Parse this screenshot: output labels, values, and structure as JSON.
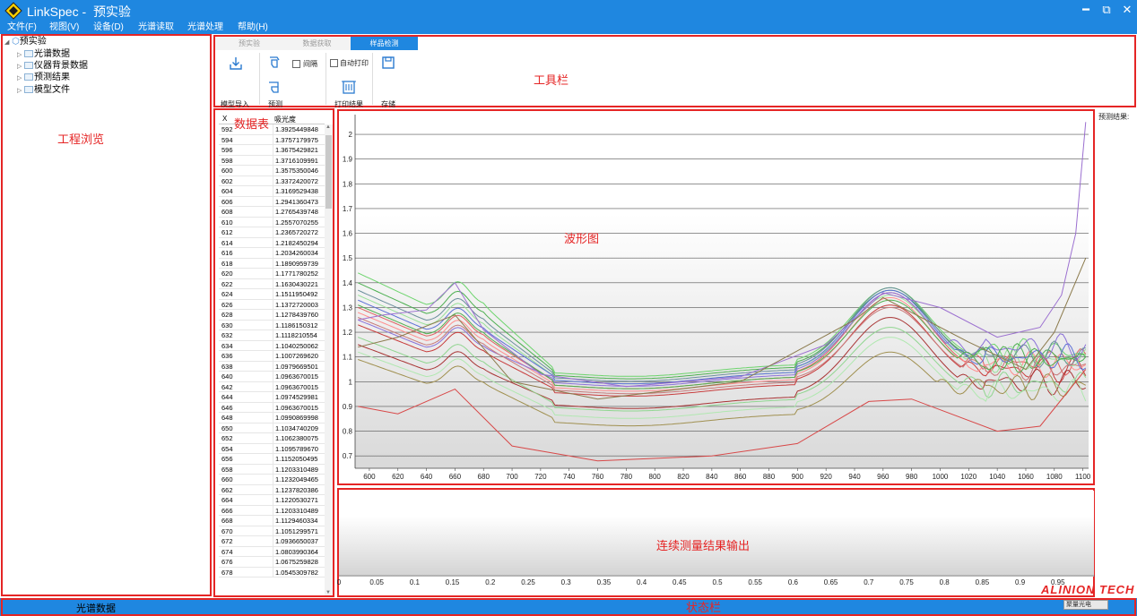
{
  "window": {
    "app_name": "LinkSpec -",
    "doc_name": "预实验",
    "minimize": "━",
    "restore": "⧉",
    "close": "✕",
    "icon": "linkspec-logo-icon"
  },
  "menu": {
    "items": [
      "文件(F)",
      "视图(V)",
      "设备(D)",
      "光谱读取",
      "光谱处理",
      "帮助(H)"
    ]
  },
  "tree": {
    "root": "预实验",
    "children": [
      "光谱数据",
      "仪器背景数据",
      "预测结果",
      "模型文件"
    ]
  },
  "tabs": {
    "items": [
      "预实验",
      "数据获取",
      "样品检测"
    ],
    "active_index": 2
  },
  "toolbar": {
    "model_import": "模型导入",
    "predict": "预测",
    "interval": "间隔",
    "auto_print": "自动打印",
    "print_result": "打印结果",
    "save": "存储",
    "predict_result_label": "预测结果:"
  },
  "annotations": {
    "project_browse": "工程浏览",
    "toolbar": "工具栏",
    "data_table": "数据表",
    "waveform": "波形图",
    "continuous_output": "连续测量结果输出",
    "statusbar": "状态栏"
  },
  "grid": {
    "col_x": "X",
    "col_y": "吸光度",
    "rows": [
      [
        "592",
        "1.3925449848"
      ],
      [
        "594",
        "1.3757179975"
      ],
      [
        "596",
        "1.3675429821"
      ],
      [
        "598",
        "1.3716109991"
      ],
      [
        "600",
        "1.3575350046"
      ],
      [
        "602",
        "1.3372420072"
      ],
      [
        "604",
        "1.3169529438"
      ],
      [
        "606",
        "1.2941360473"
      ],
      [
        "608",
        "1.2765439748"
      ],
      [
        "610",
        "1.2557070255"
      ],
      [
        "612",
        "1.2365720272"
      ],
      [
        "614",
        "1.2182450294"
      ],
      [
        "616",
        "1.2034260034"
      ],
      [
        "618",
        "1.1890959739"
      ],
      [
        "620",
        "1.1771780252"
      ],
      [
        "622",
        "1.1630430221"
      ],
      [
        "624",
        "1.1511950492"
      ],
      [
        "626",
        "1.1372720003"
      ],
      [
        "628",
        "1.1278439760"
      ],
      [
        "630",
        "1.1186150312"
      ],
      [
        "632",
        "1.1118210554"
      ],
      [
        "634",
        "1.1040250062"
      ],
      [
        "636",
        "1.1007269620"
      ],
      [
        "638",
        "1.0979669501"
      ],
      [
        "640",
        "1.0963670015"
      ],
      [
        "642",
        "1.0963670015"
      ],
      [
        "644",
        "1.0974529981"
      ],
      [
        "646",
        "1.0963670015"
      ],
      [
        "648",
        "1.0990869998"
      ],
      [
        "650",
        "1.1034740209"
      ],
      [
        "652",
        "1.1062380075"
      ],
      [
        "654",
        "1.1095789670"
      ],
      [
        "656",
        "1.1152050495"
      ],
      [
        "658",
        "1.1203310489"
      ],
      [
        "660",
        "1.1232049465"
      ],
      [
        "662",
        "1.1237820386"
      ],
      [
        "664",
        "1.1220530271"
      ],
      [
        "666",
        "1.1203310489"
      ],
      [
        "668",
        "1.1129460334"
      ],
      [
        "670",
        "1.1051299571"
      ],
      [
        "672",
        "1.0936650037"
      ],
      [
        "674",
        "1.0803990364"
      ],
      [
        "676",
        "1.0675259828"
      ],
      [
        "678",
        "1.0545309782"
      ]
    ]
  },
  "chart_data": [
    {
      "type": "line",
      "x_ticks": [
        600,
        620,
        640,
        660,
        680,
        700,
        720,
        740,
        760,
        780,
        800,
        820,
        840,
        860,
        880,
        900,
        920,
        940,
        960,
        980,
        1000,
        1020,
        1040,
        1060,
        1080,
        1100
      ],
      "y_ticks": [
        0.7,
        0.8,
        0.9,
        1,
        1.1,
        1.2,
        1.3,
        1.4,
        1.5,
        1.6,
        1.7,
        1.8,
        1.9,
        2
      ],
      "xlim": [
        590,
        1104
      ],
      "ylim": [
        0.65,
        2.08
      ],
      "grid": "horizontal",
      "series": [
        {
          "color": "#e06060",
          "base": 1.3,
          "ypeak": 0.96,
          "tail": 1.08,
          "pk": 1.36
        },
        {
          "color": "#c83c3c",
          "base": 1.23,
          "ypeak": 0.93,
          "tail": 1.05,
          "pk": 1.31
        },
        {
          "color": "#a83434",
          "base": 1.15,
          "ypeak": 0.88,
          "tail": 1.0,
          "pk": 1.26
        },
        {
          "color": "#ff8c8c",
          "base": 1.28,
          "ypeak": 0.95,
          "tail": 1.07,
          "pk": 1.34
        },
        {
          "color": "#6cd46c",
          "base": 1.44,
          "ypeak": 1.01,
          "tail": 1.12,
          "pk": 1.38
        },
        {
          "color": "#4caf50",
          "base": 1.4,
          "ypeak": 1.0,
          "tail": 1.1,
          "pk": 1.37
        },
        {
          "color": "#98e098",
          "base": 1.35,
          "ypeak": 0.98,
          "tail": 1.09,
          "pk": 1.35
        },
        {
          "color": "#8fd58f",
          "base": 1.18,
          "ypeak": 0.87,
          "tail": 0.99,
          "pk": 1.22
        },
        {
          "color": "#b0e8b0",
          "base": 1.12,
          "ypeak": 0.84,
          "tail": 0.96,
          "pk": 1.18
        },
        {
          "color": "#5b6fd6",
          "base": 1.33,
          "ypeak": 0.98,
          "tail": 1.1,
          "pk": 1.37
        },
        {
          "color": "#8a70d8",
          "base": 1.25,
          "ypeak": 0.97,
          "tail": 1.14,
          "pk": 1.36
        },
        {
          "color": "#6b8f9c",
          "base": 1.37,
          "ypeak": 0.99,
          "tail": 1.11,
          "pk": 1.38
        },
        {
          "color": "#a09050",
          "base": 1.09,
          "ypeak": 0.81,
          "tail": 0.98,
          "pk": 1.12
        },
        {
          "color": "#c87878",
          "base": 1.26,
          "ypeak": 0.94,
          "tail": 1.06,
          "pk": 1.3
        },
        {
          "color": "#50b050",
          "base": 1.31,
          "ypeak": 0.96,
          "tail": 1.09,
          "pk": 1.33
        }
      ],
      "special_series": [
        {
          "color": "#9b6fd0",
          "points": [
            [
              592,
              1.25
            ],
            [
              610,
              1.27
            ],
            [
              640,
              1.29
            ],
            [
              660,
              1.4
            ],
            [
              680,
              1.21
            ],
            [
              720,
              1.03
            ],
            [
              780,
              0.98
            ],
            [
              860,
              1.02
            ],
            [
              920,
              1.15
            ],
            [
              960,
              1.36
            ],
            [
              1000,
              1.3
            ],
            [
              1040,
              1.18
            ],
            [
              1070,
              1.22
            ],
            [
              1085,
              1.35
            ],
            [
              1095,
              1.6
            ],
            [
              1102,
              2.05
            ]
          ]
        },
        {
          "color": "#8b7a4c",
          "points": [
            [
              592,
              1.14
            ],
            [
              620,
              1.18
            ],
            [
              660,
              1.27
            ],
            [
              700,
              1.0
            ],
            [
              760,
              0.93
            ],
            [
              860,
              1.0
            ],
            [
              940,
              1.25
            ],
            [
              960,
              1.34
            ],
            [
              1020,
              1.16
            ],
            [
              1060,
              1.05
            ],
            [
              1080,
              1.2
            ],
            [
              1102,
              1.5
            ]
          ]
        },
        {
          "color": "#d84848",
          "points": [
            [
              592,
              0.9
            ],
            [
              620,
              0.87
            ],
            [
              660,
              0.97
            ],
            [
              700,
              0.74
            ],
            [
              760,
              0.68
            ],
            [
              840,
              0.7
            ],
            [
              900,
              0.75
            ],
            [
              950,
              0.92
            ],
            [
              980,
              0.93
            ],
            [
              1040,
              0.8
            ],
            [
              1070,
              0.82
            ],
            [
              1102,
              1.05
            ]
          ]
        }
      ]
    },
    {
      "type": "line",
      "x_ticks": [
        0,
        0.05,
        0.1,
        0.15,
        0.2,
        0.25,
        0.3,
        0.35,
        0.4,
        0.45,
        0.5,
        0.55,
        0.6,
        0.65,
        0.7,
        0.75,
        0.8,
        0.85,
        0.9,
        0.95
      ],
      "x_tick_labels": [
        "0",
        "0.05",
        "0.1",
        "0.15",
        "0.2",
        "0.25",
        "0.3",
        "0.35",
        "0.4",
        "0.45",
        "0.5",
        "0.55",
        "0.6",
        "0.65",
        "0.7",
        "0.75",
        "0.8",
        "0.85",
        "0.9",
        "0.95"
      ],
      "xlim": [
        0,
        1.0
      ],
      "series": []
    }
  ],
  "status": {
    "left_text": "光谱数据",
    "right_logo": "ALINION TECH",
    "right_box": "聚量光电"
  }
}
